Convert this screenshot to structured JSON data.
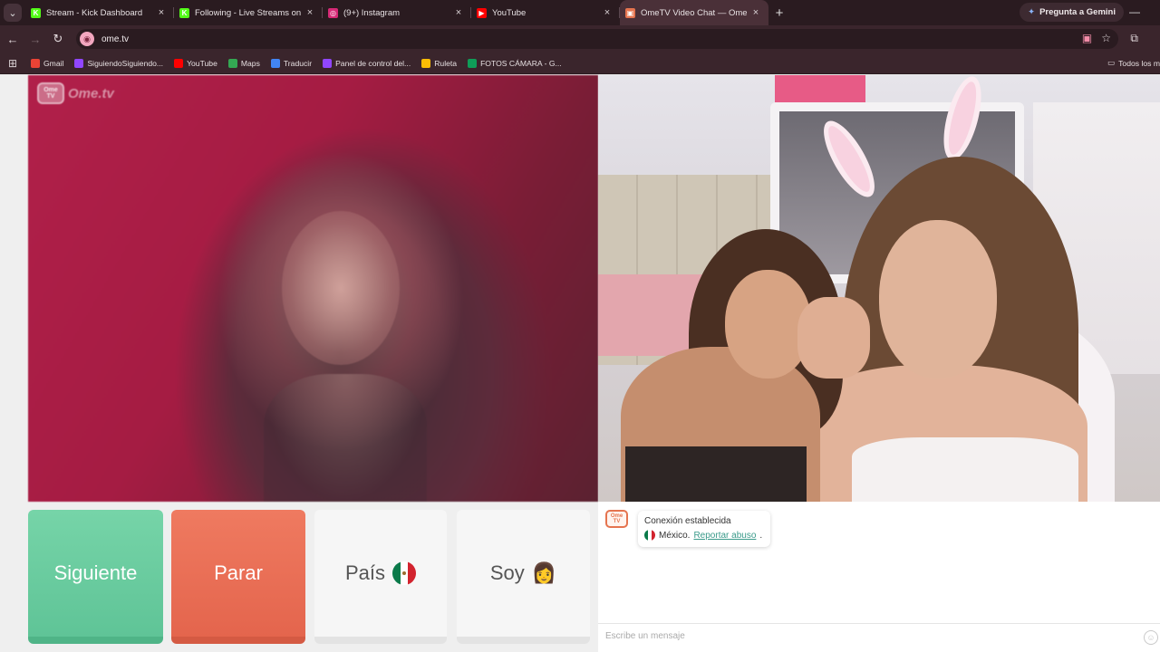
{
  "browser": {
    "tabs": [
      {
        "title": "Stream - Kick Dashboard",
        "favicon": "kick-icon",
        "color": "#53fc18",
        "glyph": "K"
      },
      {
        "title": "Following - Live Streams on Kick",
        "favicon": "kick-icon",
        "color": "#53fc18",
        "glyph": "K"
      },
      {
        "title": "(9+) Instagram",
        "favicon": "instagram-icon",
        "color": "#d62976",
        "glyph": "◎"
      },
      {
        "title": "YouTube",
        "favicon": "youtube-icon",
        "color": "#ff0000",
        "glyph": "▶"
      },
      {
        "title": "OmeTV Video Chat — Omegle",
        "favicon": "ometv-icon",
        "color": "#e5744f",
        "glyph": "▣",
        "active": true
      }
    ],
    "new_tab_glyph": "+",
    "gemini_label": "Pregunta a Gemini",
    "url": "ome.tv",
    "bookmarks": [
      {
        "label": "Gmail",
        "color": "#ea4335"
      },
      {
        "label": "SiguiendoSiguiendo...",
        "color": "#9146ff"
      },
      {
        "label": "YouTube",
        "color": "#ff0000"
      },
      {
        "label": "Maps",
        "color": "#34a853"
      },
      {
        "label": "Traducir",
        "color": "#4285f4"
      },
      {
        "label": "Panel de control del...",
        "color": "#9146ff"
      },
      {
        "label": "Ruleta",
        "color": "#fbbc05"
      },
      {
        "label": "FOTOS CÁMARA - G...",
        "color": "#0f9d58"
      }
    ],
    "all_bookmarks_label": "Todos los m"
  },
  "page": {
    "logo_text": "Ome.tv",
    "logo_badge": "Ome\nTV",
    "buttons": {
      "next": "Siguiente",
      "stop": "Parar",
      "country": "País",
      "me": "Soy",
      "me_emoji": "👩"
    },
    "colors": {
      "next": "#6fcf9f",
      "stop": "#e96e55",
      "neutral": "#f6f6f6",
      "link": "#3a9a8a"
    },
    "chat": {
      "status": "Conexión establecida",
      "country": "México.",
      "report_link": "Reportar abuso",
      "period": ".",
      "input_placeholder": "Escribe un mensaje"
    }
  }
}
